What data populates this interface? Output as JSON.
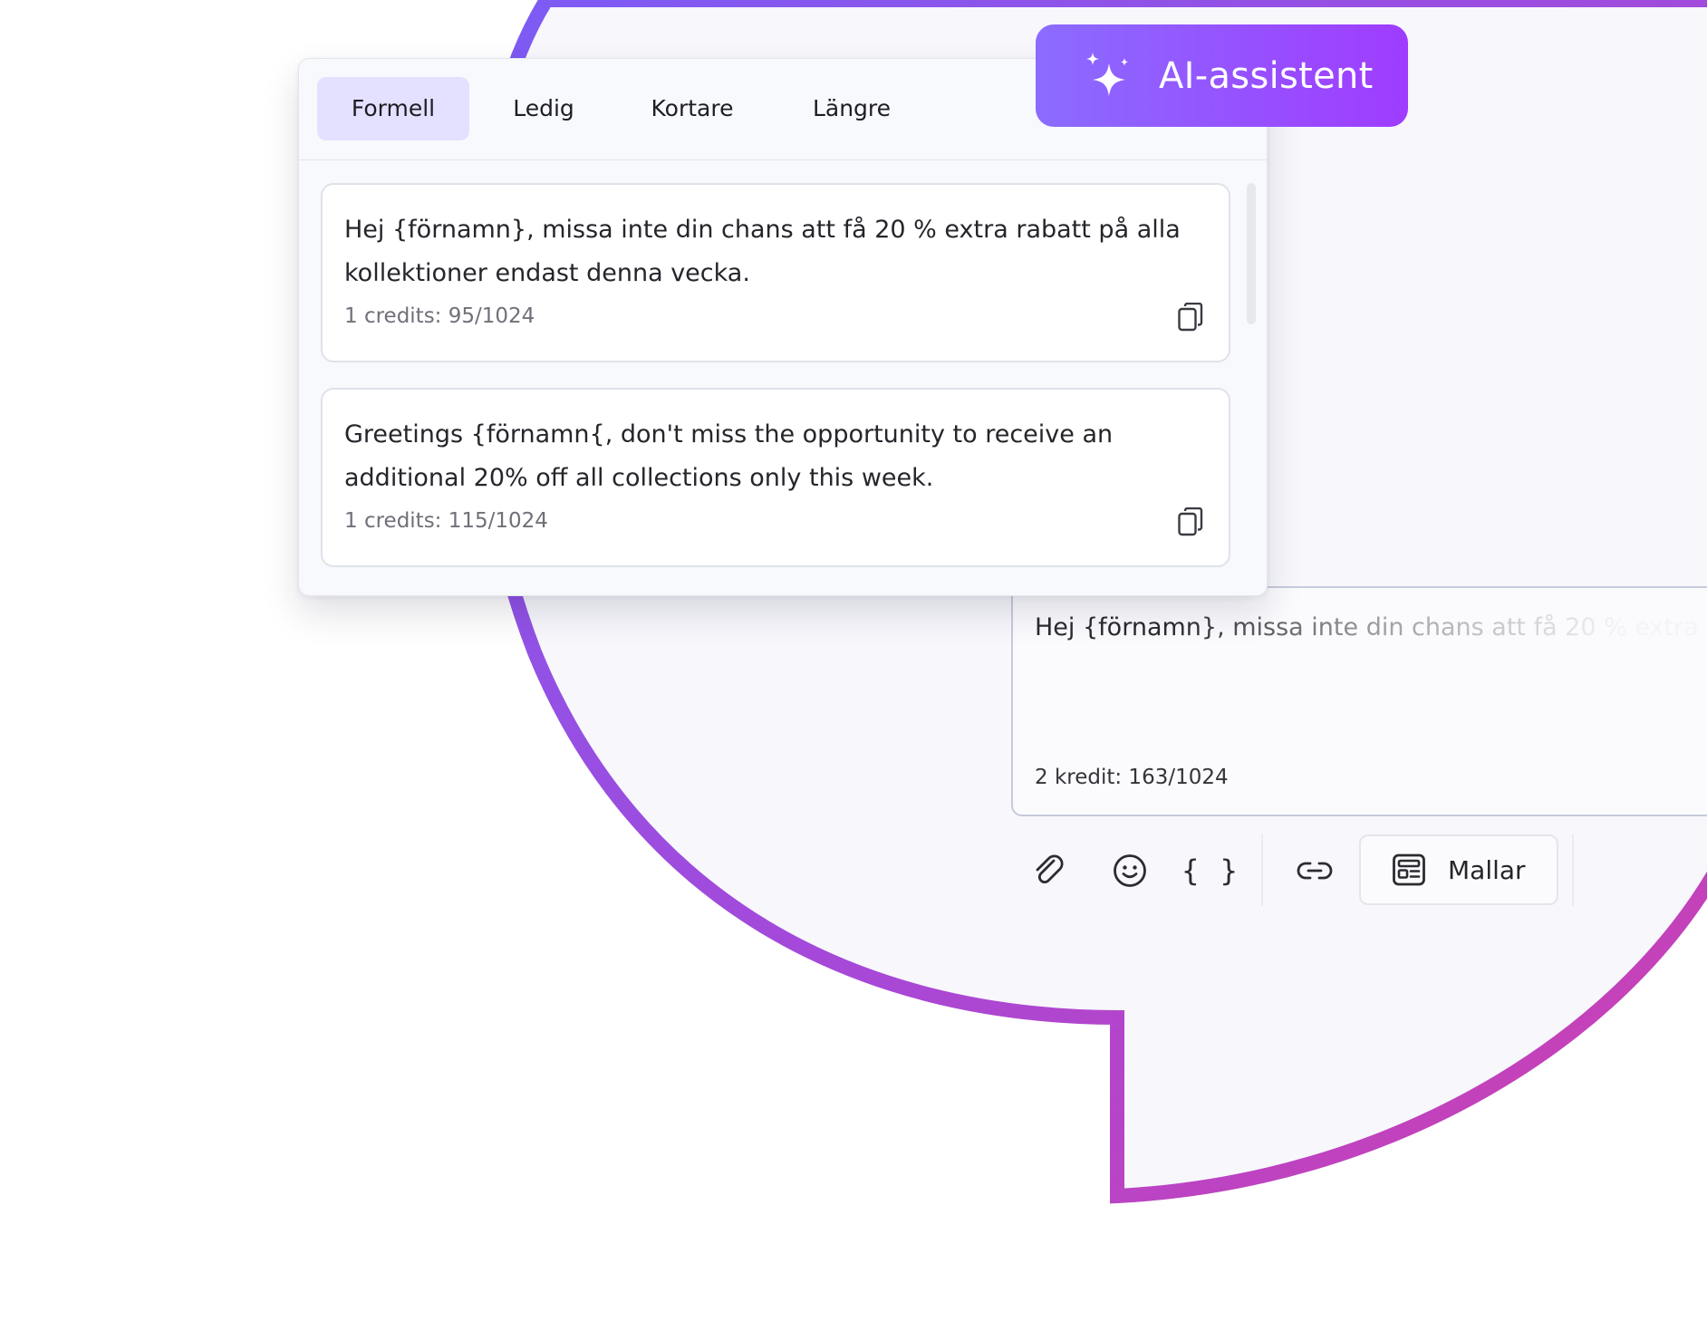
{
  "colors": {
    "accent_start": "#8b6cff",
    "accent_end": "#9f3cff",
    "bubble_gradient": [
      "#7b5cf5",
      "#a648d8",
      "#cf3fae"
    ],
    "active_tab": "#e4e0ff"
  },
  "ai_assistant": {
    "icon": "sparkle-icon",
    "label": "AI-assistent"
  },
  "tabs": [
    {
      "label": "Formell",
      "active": true
    },
    {
      "label": "Ledig",
      "active": false
    },
    {
      "label": "Kortare",
      "active": false
    },
    {
      "label": "Längre",
      "active": false
    }
  ],
  "suggestions": [
    {
      "text": "Hej {förnamn}, missa inte din chans att få 20 % extra rabatt på alla kollektioner endast denna vecka.",
      "meta": "1 credits: 95/1024",
      "copy_icon": "copy-icon"
    },
    {
      "text": "Greetings {förnamn{, don't miss the opportunity to receive an additional 20% off all collections only this week.",
      "meta": "1 credits: 115/1024",
      "copy_icon": "copy-icon"
    }
  ],
  "compose": {
    "text": "Hej {förnamn}, missa inte din chans att få 20 % extra",
    "count": "2 kredit: 163/1024"
  },
  "toolbar": {
    "icons": [
      "paperclip-icon",
      "emoji-icon",
      "braces-icon",
      "link-icon",
      "template-icon"
    ],
    "braces_glyph": "{ }",
    "templates_label": "Mallar"
  }
}
